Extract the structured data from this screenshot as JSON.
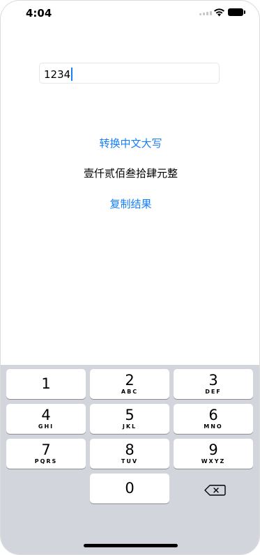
{
  "status_bar": {
    "time": "4:04"
  },
  "input": {
    "value": "1234"
  },
  "actions": {
    "convert_label": "转换中文大写",
    "result_text": "壹仟贰佰叁拾肆元整",
    "copy_label": "复制结果"
  },
  "keypad": {
    "keys": [
      {
        "num": "1",
        "letters": ""
      },
      {
        "num": "2",
        "letters": "ABC"
      },
      {
        "num": "3",
        "letters": "DEF"
      },
      {
        "num": "4",
        "letters": "GHI"
      },
      {
        "num": "5",
        "letters": "JKL"
      },
      {
        "num": "6",
        "letters": "MNO"
      },
      {
        "num": "7",
        "letters": "PQRS"
      },
      {
        "num": "8",
        "letters": "TUV"
      },
      {
        "num": "9",
        "letters": "WXYZ"
      },
      {
        "num": "0",
        "letters": ""
      }
    ],
    "delete_icon": "backspace-icon"
  },
  "colors": {
    "accent": "#147efb",
    "keyboard_bg": "#d2d5db"
  }
}
